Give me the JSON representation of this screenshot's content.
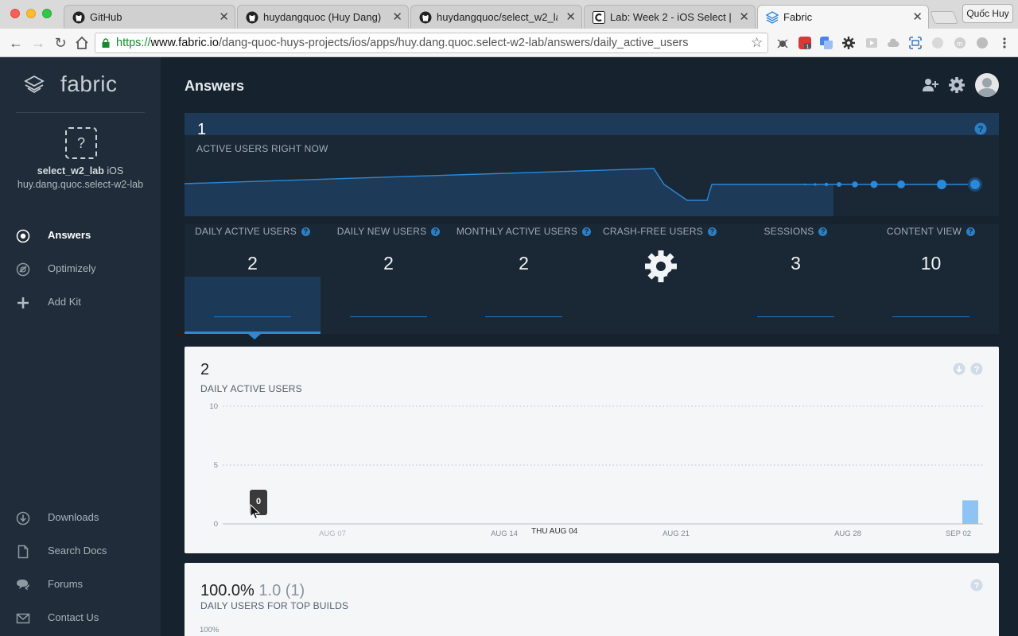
{
  "browser": {
    "tabs": [
      {
        "title": "GitHub",
        "icon": "github-icon"
      },
      {
        "title": "huydangquoc (Huy Dang)",
        "icon": "github-icon"
      },
      {
        "title": "huydangquoc/select_w2_lab",
        "icon": "github-icon"
      },
      {
        "title": "Lab: Week 2 - iOS Select | C",
        "icon": "codepath-icon"
      },
      {
        "title": "Fabric",
        "icon": "fabric-icon"
      }
    ],
    "profile": "Quốc Huy",
    "url_scheme": "https://",
    "url_host": "www.fabric.io",
    "url_path": "/dang-quoc-huys-projects/ios/apps/huy.dang.quoc.select-w2-lab/answers/daily_active_users"
  },
  "sidebar": {
    "brand": "fabric",
    "app_icon_glyph": "?",
    "app_name": "select_w2_lab",
    "app_platform": "iOS",
    "app_bundle": "huy.dang.quoc.select-w2-lab",
    "nav": [
      {
        "label": "Answers",
        "icon": "target-icon",
        "active": true
      },
      {
        "label": "Optimizely",
        "icon": "optimizely-icon",
        "active": false
      },
      {
        "label": "Add Kit",
        "icon": "plus-icon",
        "active": false
      }
    ],
    "footer": [
      {
        "label": "Downloads",
        "icon": "download-icon"
      },
      {
        "label": "Search Docs",
        "icon": "document-icon"
      },
      {
        "label": "Forums",
        "icon": "chat-icon"
      },
      {
        "label": "Contact Us",
        "icon": "mail-icon"
      }
    ]
  },
  "header": {
    "title": "Answers"
  },
  "realtime": {
    "value": "1",
    "label": "ACTIVE USERS RIGHT NOW"
  },
  "metrics": [
    {
      "label": "DAILY ACTIVE USERS",
      "value": "2",
      "active": true
    },
    {
      "label": "DAILY NEW USERS",
      "value": "2",
      "active": false
    },
    {
      "label": "MONTHLY ACTIVE USERS",
      "value": "2",
      "active": false
    },
    {
      "label": "CRASH-FREE USERS",
      "value": "",
      "active": false
    },
    {
      "label": "SESSIONS",
      "value": "3",
      "active": false
    },
    {
      "label": "CONTENT VIEW",
      "value": "10",
      "active": false
    }
  ],
  "dau_card": {
    "value": "2",
    "label": "DAILY ACTIVE USERS",
    "tooltip": "0",
    "hover_date": "THU AUG 04"
  },
  "builds_card": {
    "percent": "100.0%",
    "secondary": "1.0 (1)",
    "label": "DAILY USERS FOR TOP BUILDS",
    "y_tick": "100%"
  },
  "colors": {
    "accent": "#2a89d8",
    "sidebar": "#202c39",
    "background": "#17222f",
    "bar": "#8ec3f4"
  },
  "chart_data": {
    "type": "bar",
    "title": "",
    "xlabel": "",
    "ylabel": "",
    "ylim": [
      0,
      10
    ],
    "y_ticks": [
      "10",
      "5",
      "0"
    ],
    "x_ticks": [
      "AUG 07",
      "AUG 14",
      "AUG 21",
      "AUG 28",
      "SEP 02"
    ],
    "categories": [
      "SEP 02"
    ],
    "values": [
      2
    ],
    "grid": true
  }
}
